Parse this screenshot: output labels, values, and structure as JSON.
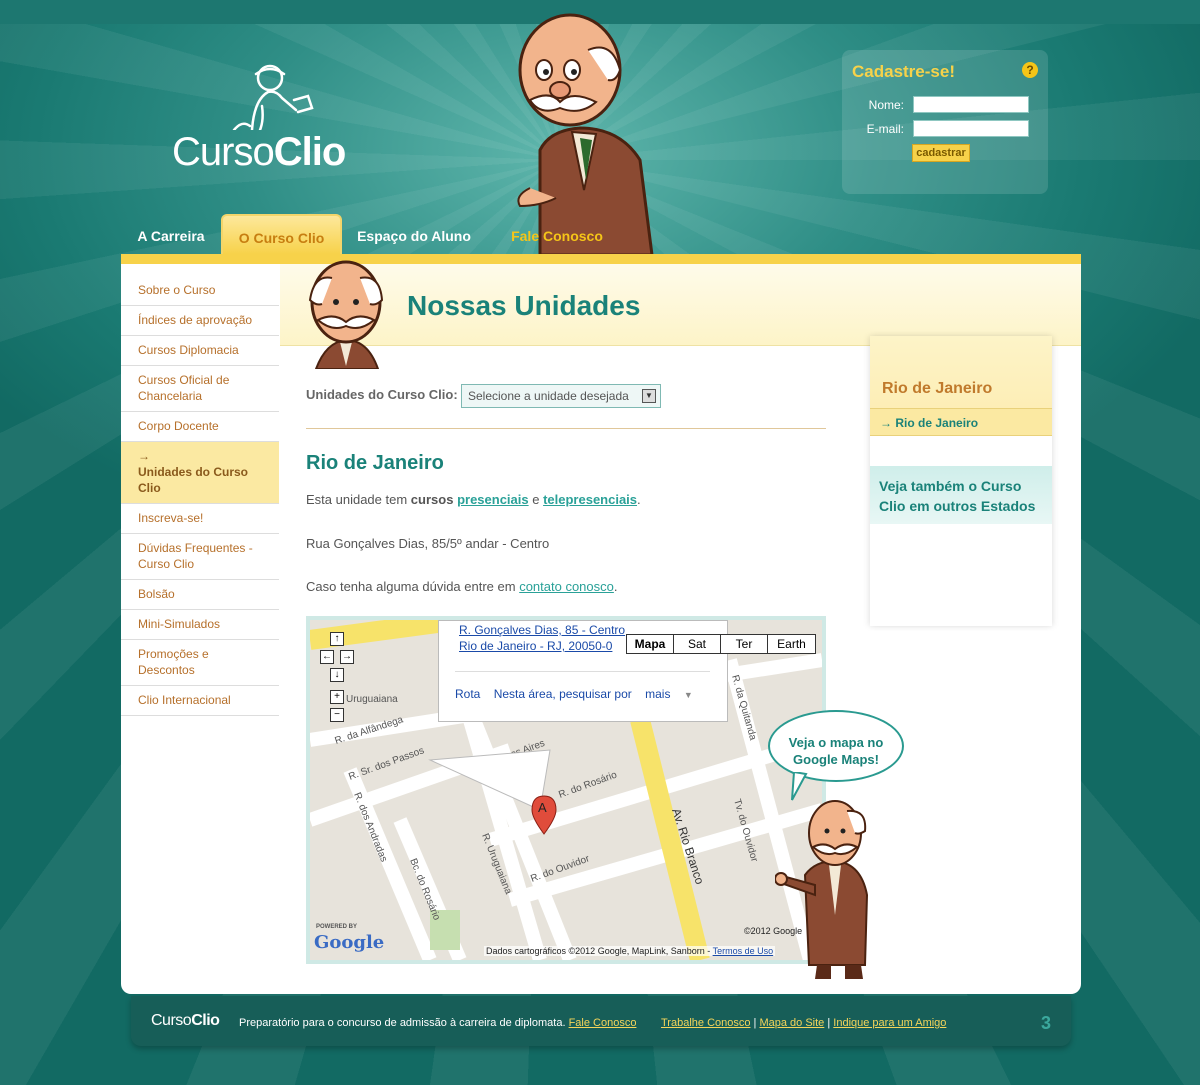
{
  "logo": {
    "part1": "Curso",
    "part2": "Clio"
  },
  "register": {
    "title": "Cadastre-se!",
    "help": "?",
    "name_label": "Nome:",
    "email_label": "E-mail:",
    "button": "cadastrar"
  },
  "nav": {
    "items": [
      {
        "label": "A Carreira"
      },
      {
        "label": "O Curso Clio"
      },
      {
        "label": "Espaço do Aluno"
      },
      {
        "label": "Fale Conosco"
      }
    ]
  },
  "sidebar": {
    "items": [
      {
        "label": "Sobre o Curso"
      },
      {
        "label": "Índices de aprovação"
      },
      {
        "label": "Cursos Diplomacia"
      },
      {
        "label": "Cursos Oficial de Chancelaria"
      },
      {
        "label": "Corpo Docente"
      },
      {
        "label": "Unidades do Curso Clio"
      },
      {
        "label": "Inscreva-se!"
      },
      {
        "label": "Dúvidas Frequentes - Curso Clio"
      },
      {
        "label": "Bolsão"
      },
      {
        "label": "Mini-Simulados"
      },
      {
        "label": "Promoções e Descontos"
      },
      {
        "label": "Clio Internacional"
      }
    ]
  },
  "page": {
    "title": "Nossas Unidades",
    "select_label": "Unidades do Curso Clio:",
    "select_value": "Selecione a unidade desejada",
    "unit_title": "Rio de Janeiro",
    "p1_a": "Esta unidade tem ",
    "p1_b": "cursos",
    "p1_link1": "presenciais",
    "p1_c": " e ",
    "p1_link2": "telepresenciais",
    "p1_d": ".",
    "address": "Rua Gonçalves Dias, 85/5º andar - Centro",
    "p3_a": "Caso tenha alguma dúvida entre em ",
    "p3_link": "contato conosco",
    "p3_b": "."
  },
  "map": {
    "addr1": "R. Gonçalves Dias, 85 - Centro",
    "addr2": "Rio de Janeiro - RJ, 20050-0",
    "types": [
      "Mapa",
      "Sat",
      "Ter",
      "Earth"
    ],
    "link_rota": "Rota",
    "link_area": "Nesta área, pesquisar por",
    "link_mais": "mais",
    "copyright": "Dados cartográficos ©2012 Google, MapLink, Sanborn - ",
    "terms": "Termos de Uso",
    "copyright2": "©2012 Google",
    "powered": "POWERED BY",
    "google": "Google",
    "marker": "A",
    "streets": [
      "R. da Alfândega",
      "R. Sr. dos Passos",
      "R. dos Andradas",
      "Bc. do Rosário",
      "R. Uruguaiana",
      "R. Buenos Aires",
      "R. do Rosário",
      "R. do Ouvidor",
      "Av. Rio Branco",
      "R. da Quitanda",
      "Tv. do Ouvidor",
      "Uruguaiana"
    ]
  },
  "rightbox": {
    "title": "Rio de Janeiro",
    "selected": "Rio de Janeiro",
    "also": "Veja também o Curso Clio em outros Estados"
  },
  "speech": "Veja o mapa no Google Maps!",
  "footer": {
    "logo1": "Curso",
    "logo2": "Clio",
    "text": "Preparatório para o concurso de admissão à carreira de diplomata. ",
    "contact": "Fale Conosco",
    "links": [
      "Trabalhe Conosco",
      "Mapa do Site",
      "Indique para um Amigo"
    ],
    "num": "3"
  },
  "colors": {
    "teal": "#1a8279",
    "gold": "#f7d24a",
    "brown": "#b6702b"
  }
}
